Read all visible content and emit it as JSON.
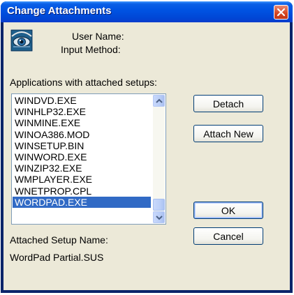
{
  "window": {
    "title": "Change Attachments"
  },
  "info": {
    "user_name_label": "User Name:",
    "input_method_label": "Input Method:"
  },
  "applications": {
    "label": "Applications with attached setups:",
    "items": [
      "WINDVD.EXE",
      "WINHLP32.EXE",
      "WINMINE.EXE",
      "WINOA386.MOD",
      "WINSETUP.BIN",
      "WINWORD.EXE",
      "WINZIP32.EXE",
      "WMPLAYER.EXE",
      "WNETPROP.CPL",
      "WORDPAD.EXE"
    ],
    "selected": "WORDPAD.EXE"
  },
  "buttons": {
    "detach": "Detach",
    "attach_new": "Attach New",
    "ok": "OK",
    "cancel": "Cancel"
  },
  "attached_setup": {
    "label": "Attached Setup Name:",
    "value": "WordPad Partial.SUS"
  },
  "colors": {
    "title_bar": "#0054e3",
    "selection": "#316ac5",
    "dialog_bg": "#ece9d8",
    "close_button": "#d5441f"
  },
  "icons": {
    "app": "eye-icon",
    "close": "close-icon",
    "scroll_up": "chevron-up-icon",
    "scroll_down": "chevron-down-icon"
  }
}
